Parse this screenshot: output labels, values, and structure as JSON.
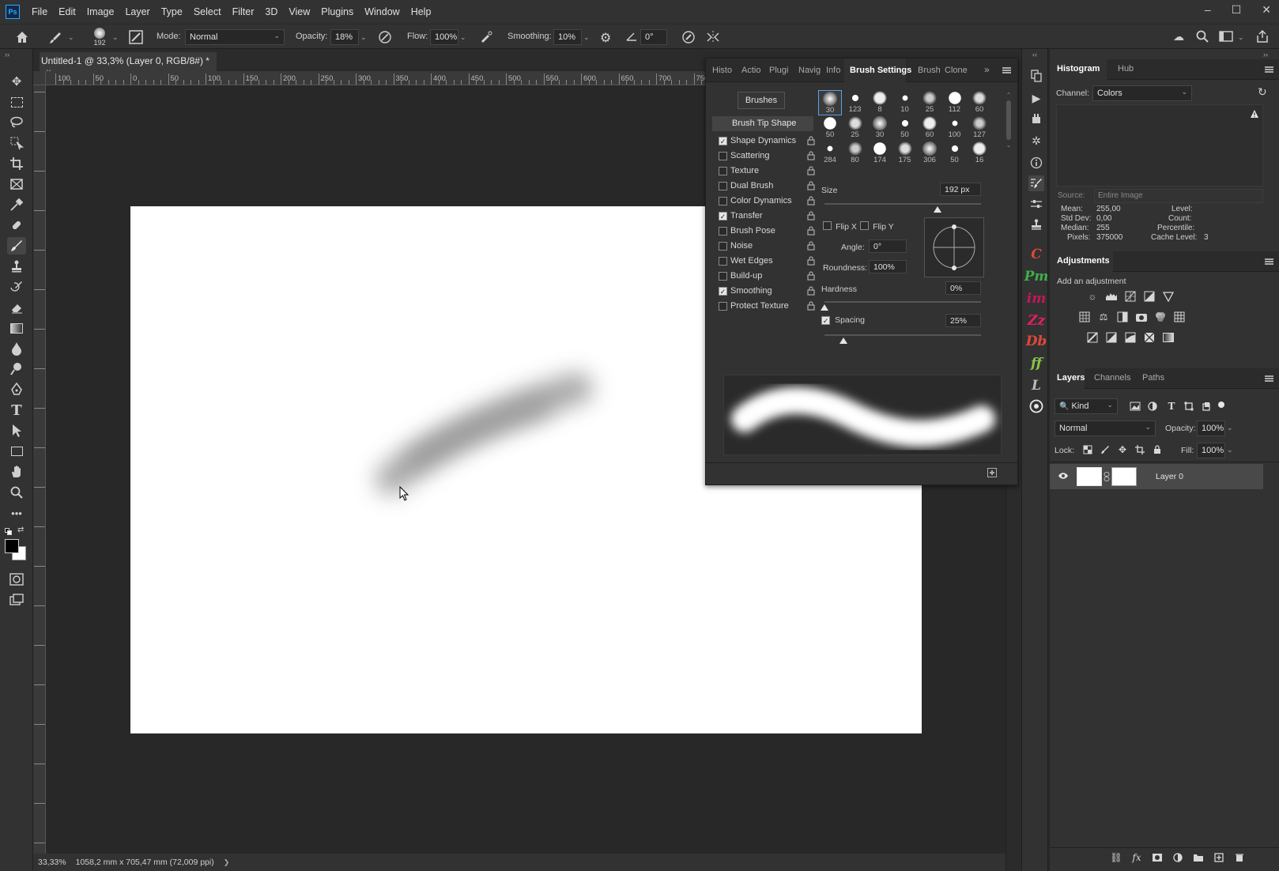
{
  "menubar": {
    "logo": "Ps",
    "items": [
      "File",
      "Edit",
      "Image",
      "Layer",
      "Type",
      "Select",
      "Filter",
      "3D",
      "View",
      "Plugins",
      "Window",
      "Help"
    ],
    "window_controls": [
      "–",
      "☐",
      "✕"
    ]
  },
  "options": {
    "brush_size": "192",
    "mode_label": "Mode:",
    "mode_value": "Normal",
    "opacity_label": "Opacity:",
    "opacity_value": "18%",
    "flow_label": "Flow:",
    "flow_value": "100%",
    "smoothing_label": "Smoothing:",
    "smoothing_value": "10%",
    "angle_value": "0°"
  },
  "document": {
    "tab_title": "Untitled-1 @ 33,3% (Layer 0, RGB/8#) *",
    "close": "×"
  },
  "ruler": {
    "h_ticks": [
      "100",
      "50",
      "0",
      "50",
      "100",
      "150",
      "200",
      "250",
      "300",
      "350",
      "400",
      "450",
      "500",
      "550",
      "600",
      "650",
      "700",
      "750"
    ]
  },
  "status": {
    "zoom": "33,33%",
    "doc_info": "1058,2 mm x 705,47 mm (72,009 ppi)",
    "arrow": "❯"
  },
  "brush_panel": {
    "tabs": [
      "Histo",
      "Actio",
      "Plugi",
      "Navig",
      "Info",
      "Brush Settings",
      "Brush",
      "Clone"
    ],
    "active_tab": "Brush Settings",
    "brushes_button": "Brushes",
    "tip_shape": "Brush Tip Shape",
    "options": [
      {
        "label": "Shape Dynamics",
        "checked": true
      },
      {
        "label": "Scattering",
        "checked": false
      },
      {
        "label": "Texture",
        "checked": false
      },
      {
        "label": "Dual Brush",
        "checked": false
      },
      {
        "label": "Color Dynamics",
        "checked": false
      },
      {
        "label": "Transfer",
        "checked": true
      },
      {
        "label": "Brush Pose",
        "checked": false
      },
      {
        "label": "Noise",
        "checked": false
      },
      {
        "label": "Wet Edges",
        "checked": false
      },
      {
        "label": "Build-up",
        "checked": false
      },
      {
        "label": "Smoothing",
        "checked": true
      },
      {
        "label": "Protect Texture",
        "checked": false
      }
    ],
    "presets": [
      "30",
      "123",
      "8",
      "10",
      "25",
      "112",
      "60",
      "50",
      "25",
      "30",
      "50",
      "60",
      "100",
      "127",
      "284",
      "80",
      "174",
      "175",
      "306",
      "50",
      "16"
    ],
    "size_label": "Size",
    "size_value": "192 px",
    "flip_x": "Flip X",
    "flip_y": "Flip Y",
    "angle_label": "Angle:",
    "angle_value": "0°",
    "roundness_label": "Roundness:",
    "roundness_value": "100%",
    "hardness_label": "Hardness",
    "hardness_value": "0%",
    "spacing_label": "Spacing",
    "spacing_value": "25%",
    "size_level": 0.72,
    "hardness_level": 0.0,
    "spacing_level": 0.12
  },
  "histogram": {
    "tabs": [
      "Histogram",
      "Hub"
    ],
    "channel_label": "Channel:",
    "channel_value": "Colors",
    "source_label": "Source:",
    "source_value": "Entire Image",
    "mean_label": "Mean:",
    "mean_value": "255,00",
    "stddev_label": "Std Dev:",
    "stddev_value": "0,00",
    "median_label": "Median:",
    "median_value": "255",
    "pixels_label": "Pixels:",
    "pixels_value": "375000",
    "level_label": "Level:",
    "count_label": "Count:",
    "percentile_label": "Percentile:",
    "cache_label": "Cache Level:",
    "cache_value": "3"
  },
  "adjustments": {
    "title": "Adjustments",
    "subtitle": "Add an adjustment"
  },
  "layers": {
    "tabs": [
      "Layers",
      "Channels",
      "Paths"
    ],
    "kind_label": "Kind",
    "blend_mode": "Normal",
    "opacity_label": "Opacity:",
    "opacity_value": "100%",
    "lock_label": "Lock:",
    "fill_label": "Fill:",
    "fill_value": "100%",
    "layer_name": "Layer 0"
  },
  "colors": {
    "accent": "#31a8ff",
    "panel_bg": "#323232",
    "plugin_c": "#e0483a",
    "plugin_pm": "#3fae49",
    "plugin_im": "#c2185b",
    "plugin_zz": "#e91e63",
    "plugin_db": "#e0483a",
    "plugin_ff": "#8bc34a"
  }
}
